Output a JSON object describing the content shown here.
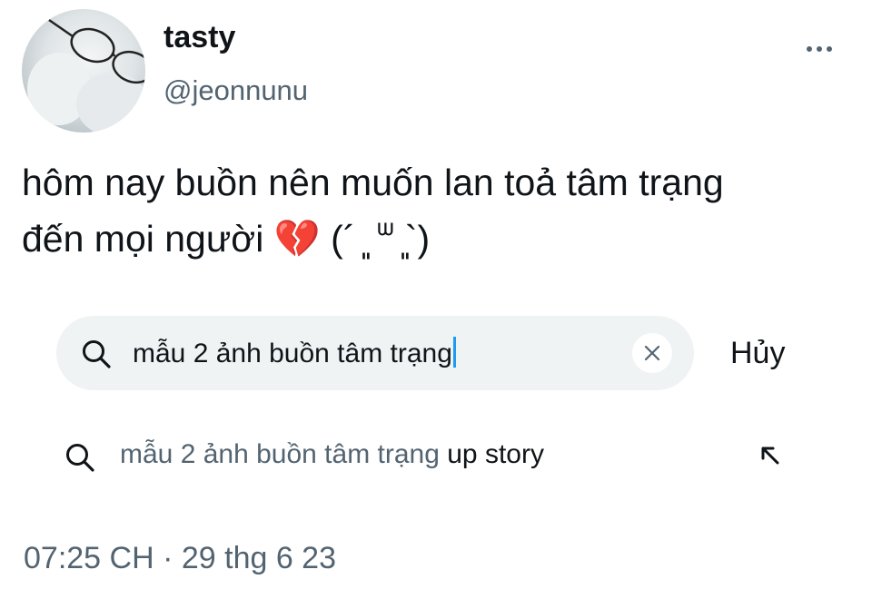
{
  "profile": {
    "display_name": "tasty",
    "handle": "@jeonnunu"
  },
  "tweet": {
    "line1": "hôm nay buồn nên muốn lan toả tâm trạng",
    "line2": "đến mọi người 💔 (´ ͈ ᐜ ͈`)"
  },
  "search": {
    "query": "mẫu 2 ảnh buồn tâm trạng",
    "cancel_label": "Hủy"
  },
  "suggestion": {
    "typed": "mẫu 2 ảnh buồn tâm trạng",
    "completion": " up story"
  },
  "timestamp": "07:25 CH · 29 thg 6 23",
  "icons": {
    "more": "more-horizontal-icon",
    "search": "search-icon",
    "clear": "close-icon",
    "fill": "arrow-up-left-icon"
  },
  "colors": {
    "text": "#0f1419",
    "secondary": "#536471",
    "search_bg": "#eff3f4",
    "caret": "#1d9bf0"
  }
}
